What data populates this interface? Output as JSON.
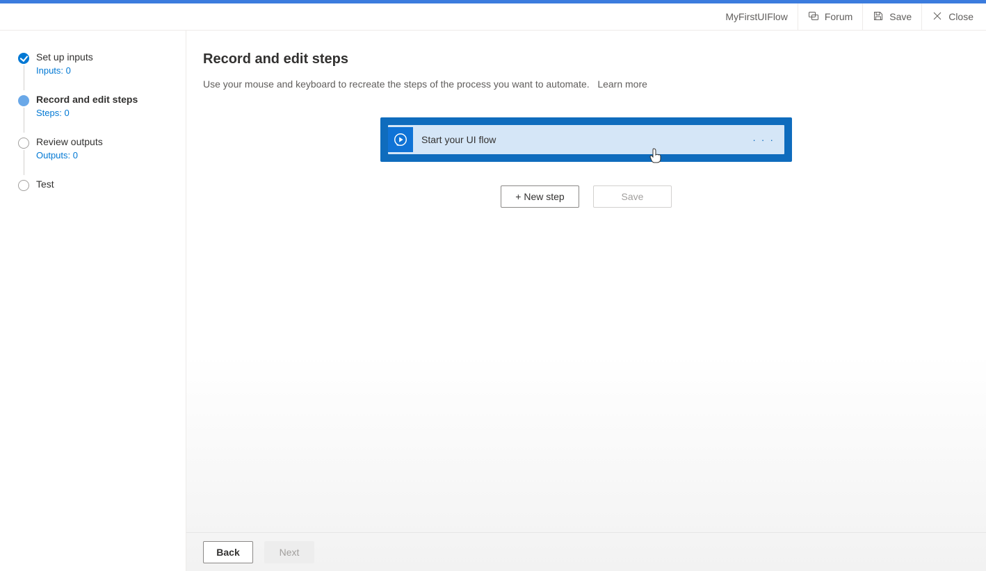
{
  "header": {
    "flow_name": "MyFirstUIFlow",
    "forum": "Forum",
    "save": "Save",
    "close": "Close"
  },
  "sidebar": {
    "steps": [
      {
        "title": "Set up inputs",
        "sub": "Inputs: 0"
      },
      {
        "title": "Record and edit steps",
        "sub": "Steps: 0"
      },
      {
        "title": "Review outputs",
        "sub": "Outputs: 0"
      },
      {
        "title": "Test",
        "sub": ""
      }
    ]
  },
  "main": {
    "title": "Record and edit steps",
    "desc": "Use your mouse and keyboard to recreate the steps of the process you want to automate.",
    "learn_more": "Learn more",
    "card_label": "Start your UI flow",
    "new_step": "+ New step",
    "save_btn": "Save"
  },
  "footer": {
    "back": "Back",
    "next": "Next"
  }
}
